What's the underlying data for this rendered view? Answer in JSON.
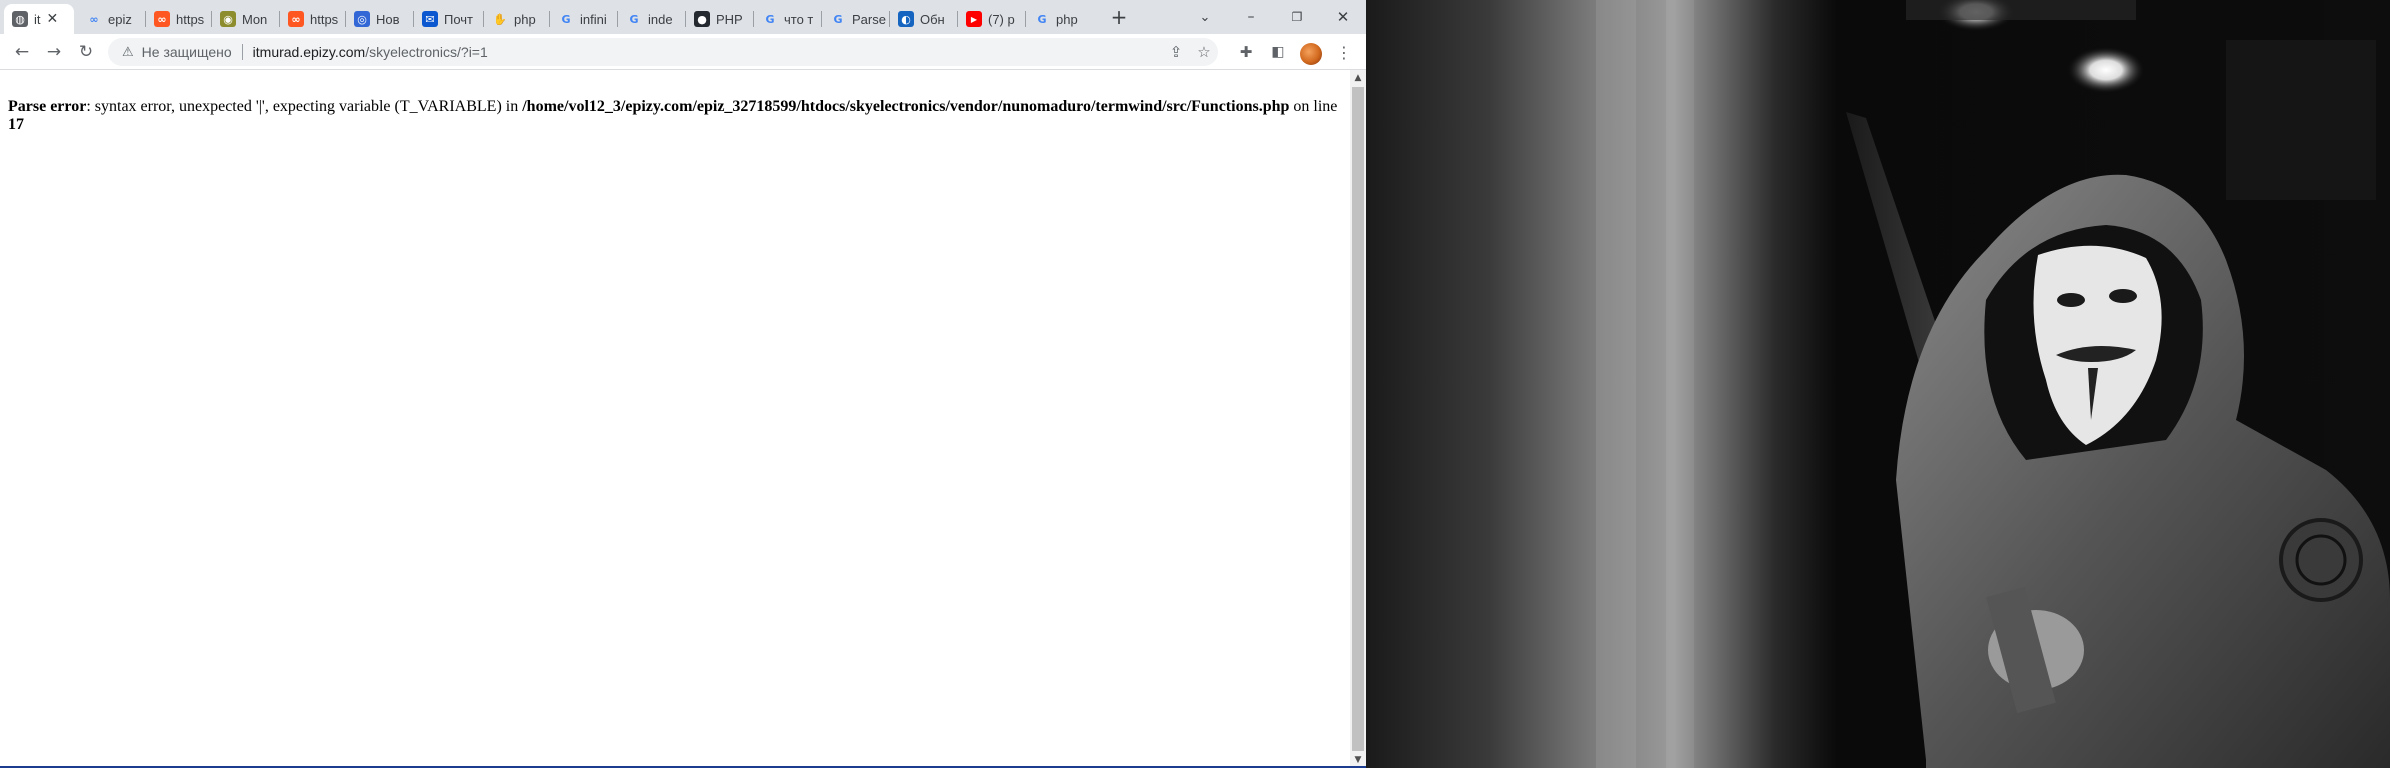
{
  "browser": {
    "tabs": [
      {
        "label": "it",
        "icon": "globe-icon",
        "active": true
      },
      {
        "label": "epiz",
        "icon": "infinity-icon"
      },
      {
        "label": "https",
        "icon": "link-icon"
      },
      {
        "label": "Mon",
        "icon": "monitor-icon"
      },
      {
        "label": "https",
        "icon": "link-icon"
      },
      {
        "label": "Нов",
        "icon": "news-icon"
      },
      {
        "label": "Почт",
        "icon": "mail-icon"
      },
      {
        "label": "php",
        "icon": "php-icon"
      },
      {
        "label": "infini",
        "icon": "google-icon"
      },
      {
        "label": "inde",
        "icon": "google-icon"
      },
      {
        "label": "PHP",
        "icon": "github-icon"
      },
      {
        "label": "что т",
        "icon": "google-icon"
      },
      {
        "label": "Parse",
        "icon": "google-icon"
      },
      {
        "label": "Обн",
        "icon": "update-icon"
      },
      {
        "label": "(7) p",
        "icon": "youtube-icon"
      },
      {
        "label": "php",
        "icon": "google-icon"
      }
    ],
    "new_tab_symbol": "+",
    "address_bar": {
      "security_label": "Не защищено",
      "host": "itmurad.epizy.com",
      "path": "/skyelectronics/?i=1"
    }
  },
  "page": {
    "error": {
      "title": "Parse error",
      "message": ": syntax error, unexpected '|', expecting variable (T_VARIABLE) in ",
      "file": "/home/vol12_3/epizy.com/epiz_32718599/htdocs/skyelectronics/vendor/nunomaduro/termwind/src/Functions.php",
      "line_prefix": " on line ",
      "line": "17"
    }
  },
  "colors": {
    "tab_strip": "#dee1e6",
    "omnibox": "#f1f3f4",
    "wallpaper": "#0c0c0c"
  }
}
